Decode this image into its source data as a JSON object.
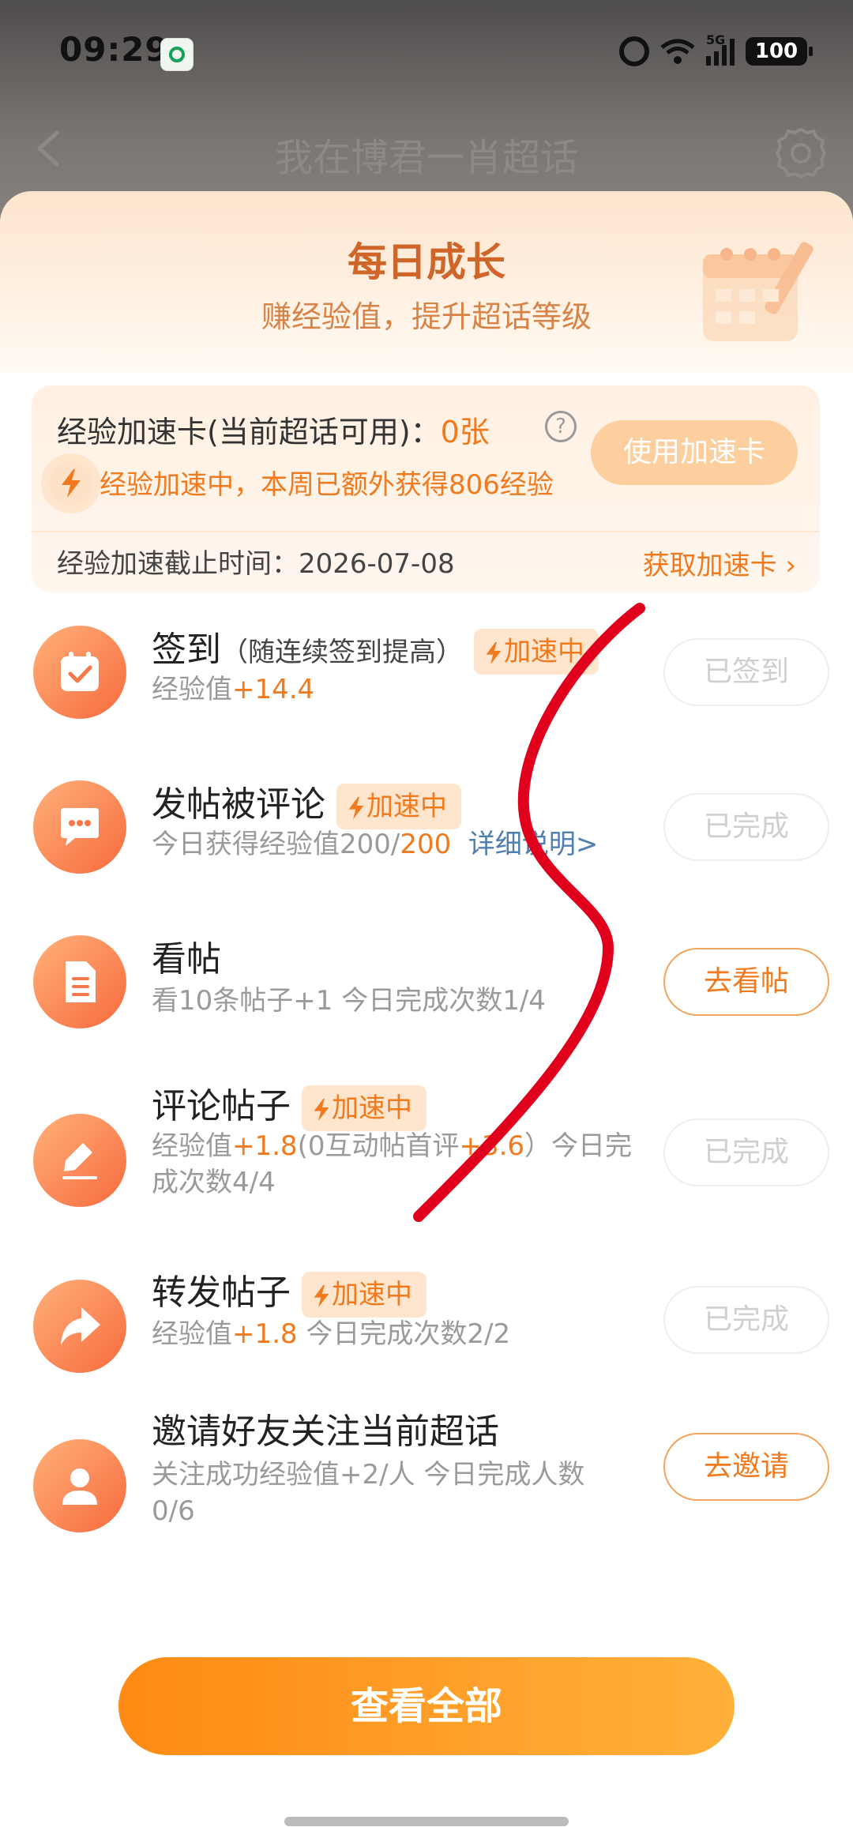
{
  "status_bar": {
    "time": "09:29",
    "network": "5G",
    "battery": "100"
  },
  "nav": {
    "title": "我在博君一肖超话"
  },
  "header": {
    "title": "每日成长",
    "subtitle": "赚经验值，提升超话等级"
  },
  "boost_card": {
    "title": "经验加速卡(当前超话可用)：",
    "count": "0张",
    "help": "?",
    "use_button": "使用加速卡",
    "status_text": "经验加速中，本周已额外获得806经验",
    "deadline": "经验加速截止时间：2026-07-08",
    "get_link": "获取加速卡"
  },
  "tasks": [
    {
      "title": "签到",
      "note": "（随连续签到提高）",
      "tag": "加速中",
      "desc_prefix": "经验值",
      "desc_value": "+14.4",
      "button": "已签到"
    },
    {
      "title": "发帖被评论",
      "tag": "加速中",
      "desc_prefix": "今日获得经验值200/",
      "desc_value": "200",
      "desc_link": "详细说明>",
      "button": "已完成"
    },
    {
      "title": "看帖",
      "desc": "看10条帖子+1   今日完成次数1/4",
      "button": "去看帖"
    },
    {
      "title": "评论帖子",
      "tag": "加速中",
      "desc_a": "经验值",
      "desc_b": "+1.8",
      "desc_c": "(0互动帖首评",
      "desc_d": "+3.6",
      "desc_e": "）今日完",
      "desc_line2": "成次数4/4",
      "button": "已完成"
    },
    {
      "title": "转发帖子",
      "tag": "加速中",
      "desc_prefix": "经验值",
      "desc_value": "+1.8",
      "desc_suffix": "  今日完成次数2/2",
      "button": "已完成"
    },
    {
      "title": "邀请好友关注当前超话",
      "desc_line1": "关注成功经验值+2/人   今日完成人数",
      "desc_line2": "0/6",
      "button": "去邀请"
    }
  ],
  "view_all_button": "查看全部",
  "colors": {
    "accent": "#f07a1d",
    "button_gradient_start": "#ff8a13",
    "button_gradient_end": "#ffb13b",
    "scribble": "#e0001b"
  }
}
